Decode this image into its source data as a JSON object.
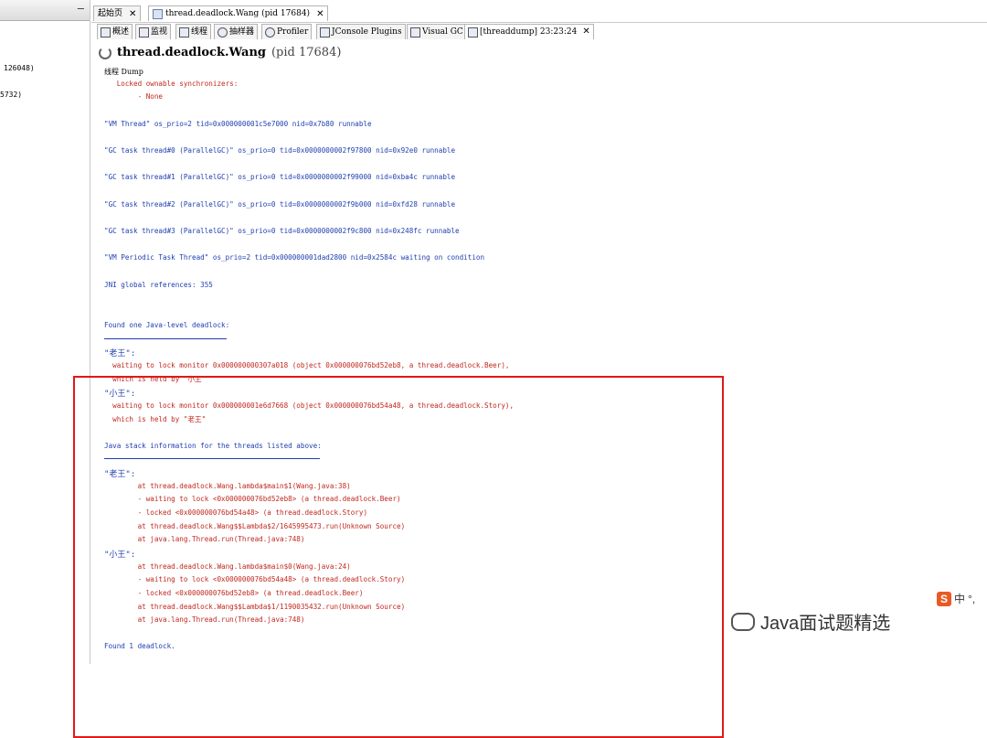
{
  "left_panel": {
    "rows": [
      "126048)",
      "5732)"
    ]
  },
  "tabs": [
    {
      "label": "起始页"
    },
    {
      "label": "thread.deadlock.Wang (pid 17684)"
    }
  ],
  "toolbar_tabs": [
    "概述",
    "监视",
    "线程",
    "抽样器",
    "Profiler",
    "JConsole Plugins",
    "Visual GC",
    "[threaddump] 23:23:24"
  ],
  "header": {
    "title": "thread.deadlock.Wang",
    "pid": "(pid 17684)",
    "subtitle": "线程 Dump"
  },
  "dump": {
    "l0": "   Locked ownable synchronizers:",
    "l1": "        - None",
    "l2": "\"VM Thread\" os_prio=2 tid=0x000000001c5e7000 nid=0x7b80 runnable",
    "l3": "\"GC task thread#0 (ParallelGC)\" os_prio=0 tid=0x0000000002f97800 nid=0x92e0 runnable",
    "l4": "\"GC task thread#1 (ParallelGC)\" os_prio=0 tid=0x0000000002f99000 nid=0xba4c runnable",
    "l5": "\"GC task thread#2 (ParallelGC)\" os_prio=0 tid=0x0000000002f9b000 nid=0xfd28 runnable",
    "l6": "\"GC task thread#3 (ParallelGC)\" os_prio=0 tid=0x0000000002f9c800 nid=0x248fc runnable",
    "l7": "\"VM Periodic Task Thread\" os_prio=2 tid=0x000000001dad2800 nid=0x2584c waiting on condition",
    "l8": "JNI global references: 355",
    "l9": "Found one Java-level deadlock:",
    "l10": "\"老王\":",
    "l11": "  waiting to lock monitor 0x000000000307a018 (object 0x000000076bd52eb8, a thread.deadlock.Beer),",
    "l12": "  which is held by \"小王\"",
    "l13": "\"小王\":",
    "l14": "  waiting to lock monitor 0x000000001e6d7668 (object 0x000000076bd54a48, a thread.deadlock.Story),",
    "l15": "  which is held by \"老王\"",
    "l16": "Java stack information for the threads listed above:",
    "l17": "\"老王\":",
    "l18": "        at thread.deadlock.Wang.lambda$main$1(Wang.java:38)",
    "l19": "        - waiting to lock <0x000000076bd52eb8> (a thread.deadlock.Beer)",
    "l20": "        - locked <0x000000076bd54a48> (a thread.deadlock.Story)",
    "l21": "        at thread.deadlock.Wang$$Lambda$2/1645995473.run(Unknown Source)",
    "l22": "        at java.lang.Thread.run(Thread.java:748)",
    "l23": "\"小王\":",
    "l24": "        at thread.deadlock.Wang.lambda$main$0(Wang.java:24)",
    "l25": "        - waiting to lock <0x000000076bd54a48> (a thread.deadlock.Story)",
    "l26": "        - locked <0x000000076bd52eb8> (a thread.deadlock.Beer)",
    "l27": "        at thread.deadlock.Wang$$Lambda$1/1190035432.run(Unknown Source)",
    "l28": "        at java.lang.Thread.run(Thread.java:748)",
    "l29": "Found 1 deadlock."
  },
  "watermark": "Java面试题精选",
  "ime": "中",
  "colors": {
    "accent_blue": "#1f3fb0",
    "accent_red": "#c0281f",
    "highlight_border": "#e21818"
  }
}
